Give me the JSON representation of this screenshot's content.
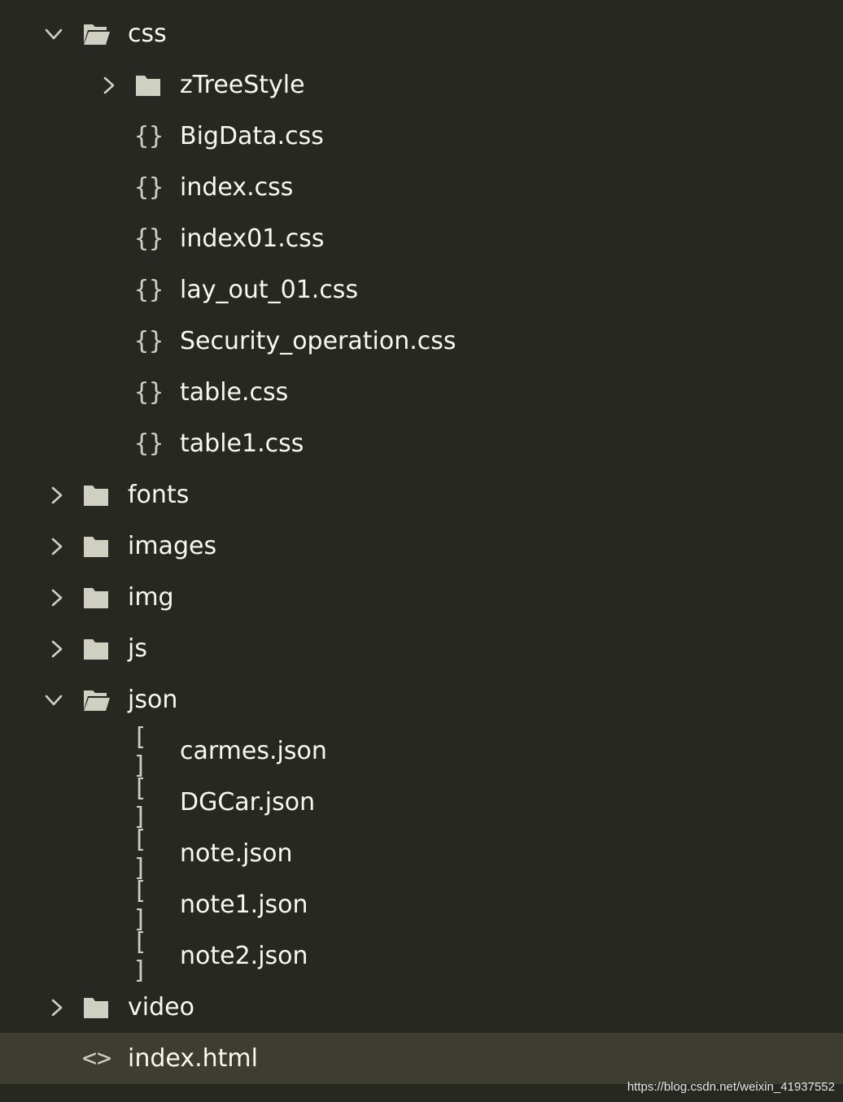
{
  "tree": [
    {
      "kind": "folder",
      "open": true,
      "depth": 1,
      "icon": "folder-open-icon",
      "label": "css"
    },
    {
      "kind": "folder",
      "open": false,
      "depth": 2,
      "icon": "folder-icon",
      "label": "zTreeStyle"
    },
    {
      "kind": "file",
      "depth": 2,
      "icon": "braces-icon",
      "glyph": "{}",
      "label": "BigData.css"
    },
    {
      "kind": "file",
      "depth": 2,
      "icon": "braces-icon",
      "glyph": "{}",
      "label": "index.css"
    },
    {
      "kind": "file",
      "depth": 2,
      "icon": "braces-icon",
      "glyph": "{}",
      "label": "index01.css"
    },
    {
      "kind": "file",
      "depth": 2,
      "icon": "braces-icon",
      "glyph": "{}",
      "label": "lay_out_01.css"
    },
    {
      "kind": "file",
      "depth": 2,
      "icon": "braces-icon",
      "glyph": "{}",
      "label": "Security_operation.css"
    },
    {
      "kind": "file",
      "depth": 2,
      "icon": "braces-icon",
      "glyph": "{}",
      "label": "table.css"
    },
    {
      "kind": "file",
      "depth": 2,
      "icon": "braces-icon",
      "glyph": "{}",
      "label": "table1.css"
    },
    {
      "kind": "folder",
      "open": false,
      "depth": 1,
      "icon": "folder-icon",
      "label": "fonts"
    },
    {
      "kind": "folder",
      "open": false,
      "depth": 1,
      "icon": "folder-icon",
      "label": "images"
    },
    {
      "kind": "folder",
      "open": false,
      "depth": 1,
      "icon": "folder-icon",
      "label": "img"
    },
    {
      "kind": "folder",
      "open": false,
      "depth": 1,
      "icon": "folder-icon",
      "label": "js"
    },
    {
      "kind": "folder",
      "open": true,
      "depth": 1,
      "icon": "folder-open-icon",
      "label": "json"
    },
    {
      "kind": "file",
      "depth": 2,
      "icon": "brackets-icon",
      "glyph": "[ ]",
      "label": "carmes.json"
    },
    {
      "kind": "file",
      "depth": 2,
      "icon": "brackets-icon",
      "glyph": "[ ]",
      "label": "DGCar.json"
    },
    {
      "kind": "file",
      "depth": 2,
      "icon": "brackets-icon",
      "glyph": "[ ]",
      "label": "note.json"
    },
    {
      "kind": "file",
      "depth": 2,
      "icon": "brackets-icon",
      "glyph": "[ ]",
      "label": "note1.json"
    },
    {
      "kind": "file",
      "depth": 2,
      "icon": "brackets-icon",
      "glyph": "[ ]",
      "label": "note2.json"
    },
    {
      "kind": "folder",
      "open": false,
      "depth": 1,
      "icon": "folder-icon",
      "label": "video"
    },
    {
      "kind": "file",
      "depth": 1,
      "icon": "code-icon",
      "glyph": "<>",
      "label": "index.html",
      "selected": true
    }
  ],
  "watermark": "https://blog.csdn.net/weixin_41937552",
  "colors": {
    "background": "#272822",
    "selected_row": "#3e3d32",
    "text": "#f8f8f2",
    "icon": "#cfcfc2"
  }
}
